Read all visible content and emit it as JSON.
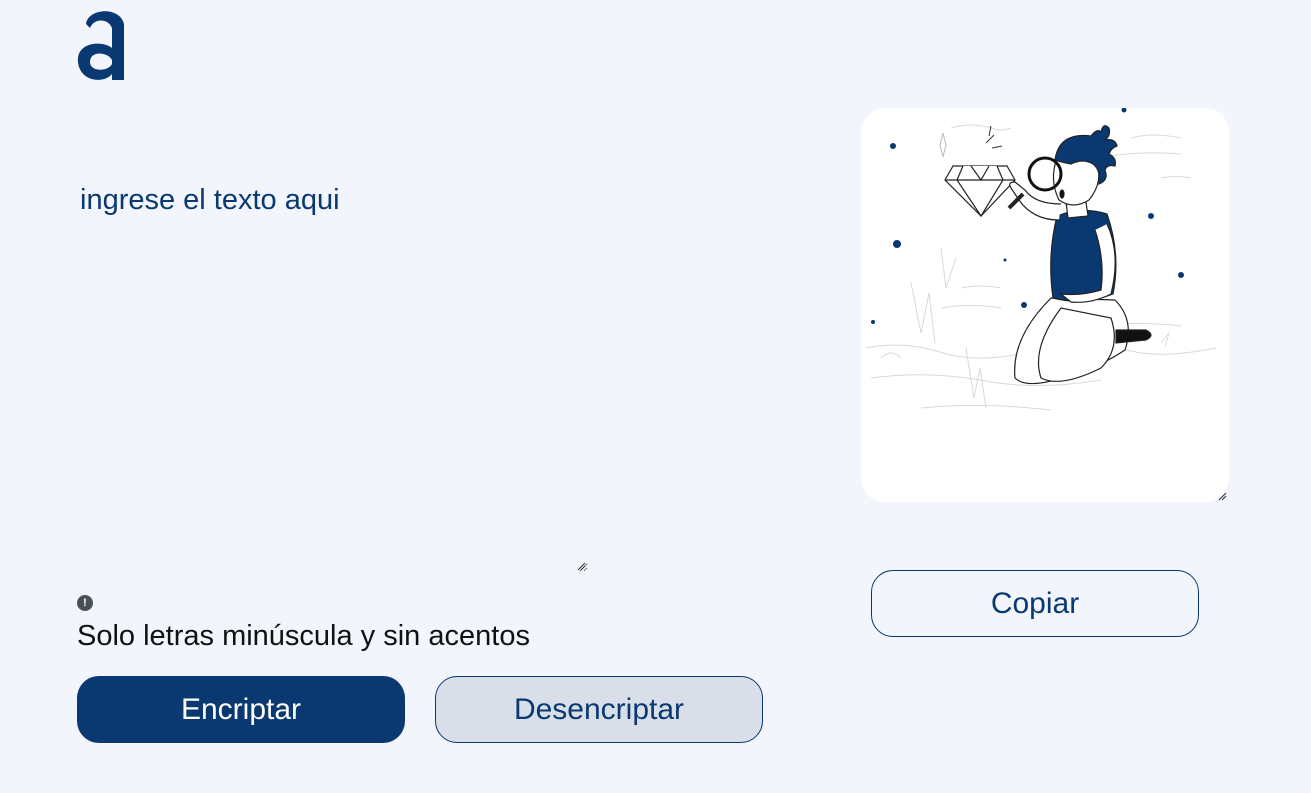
{
  "brand": {
    "logo_letter": "a",
    "accent": "#0a3871"
  },
  "input": {
    "placeholder": "ingrese el texto aqui",
    "value": ""
  },
  "notice": {
    "icon": "info-icon",
    "text": "Solo letras minúscula y sin acentos"
  },
  "buttons": {
    "encrypt_label": "Encriptar",
    "decrypt_label": "Desencriptar",
    "copy_label": "Copiar"
  },
  "output": {
    "illustration": "person-with-magnifying-glass-and-diamond"
  }
}
